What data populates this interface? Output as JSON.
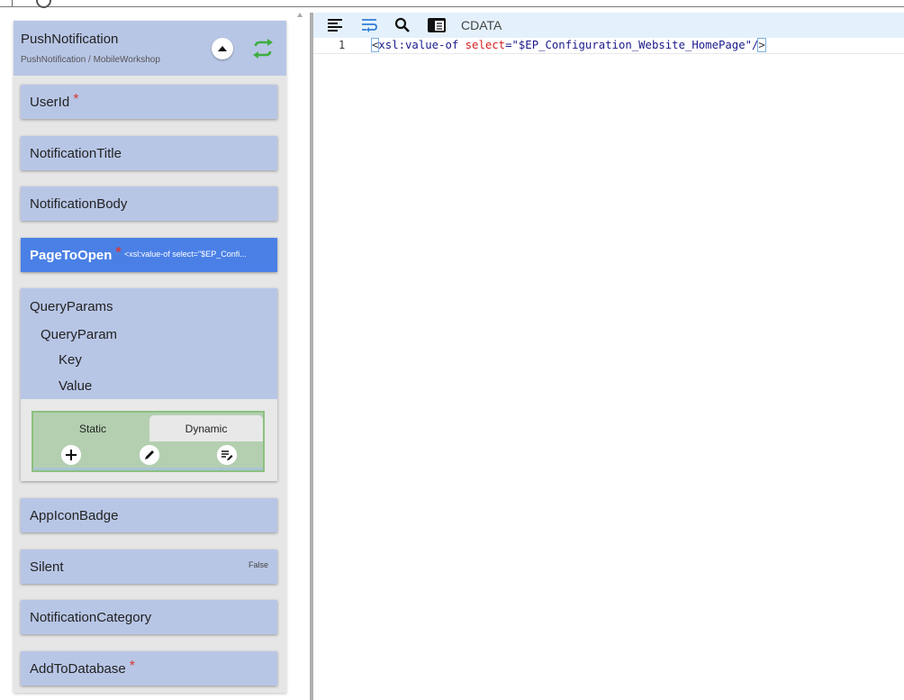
{
  "left_panel": {
    "title": "PushNotification",
    "subtitle": "PushNotification / MobileWorkshop",
    "fields": {
      "userid": "UserId",
      "notification_title": "NotificationTitle",
      "notification_body": "NotificationBody",
      "page_to_open": "PageToOpen",
      "page_to_open_preview": "<xsl:value-of select=\"$EP_Confi...",
      "app_icon_badge": "AppIconBadge",
      "silent": "Silent",
      "silent_value": "False",
      "notification_category": "NotificationCategory",
      "add_to_database": "AddToDatabase"
    },
    "required_marker": "*",
    "query_params": {
      "title": "QueryParams",
      "child": "QueryParam",
      "key": "Key",
      "value": "Value",
      "tabs": {
        "static": "Static",
        "dynamic": "Dynamic"
      }
    }
  },
  "editor": {
    "cdata_label": "CDATA",
    "line_number": "1",
    "code": {
      "open": "<",
      "tag": "xsl:value-of",
      "space": " ",
      "attr": "select",
      "eq": "=",
      "value": "\"$EP_Configuration_Website_HomePage\"",
      "slash": "/",
      "close": ">"
    }
  },
  "colors": {
    "field_bg": "#b8c6e6",
    "active_field_bg": "#4a80e6",
    "required": "#d63a3a",
    "toolbar_bg": "#e4f1fc",
    "tabs_green": "#b3cfb0"
  },
  "icons": [
    "collapse-icon",
    "sync-icon",
    "format-icon",
    "wrap-icon",
    "search-icon",
    "view-icon",
    "add-icon",
    "edit-icon",
    "list-edit-icon"
  ]
}
